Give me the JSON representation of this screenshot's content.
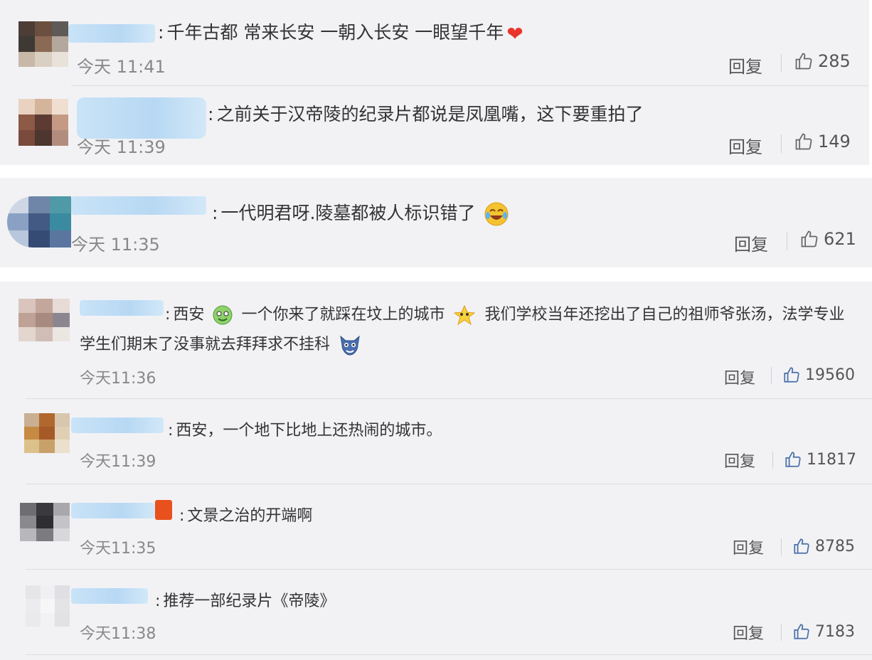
{
  "actions": {
    "reply_label": "回复"
  },
  "comments": [
    {
      "separator": ":",
      "text": "千年古都 常来长安 一朝入长安 一眼望千年",
      "emoji": "heart",
      "time": "今天 11:41",
      "likes": "285"
    },
    {
      "separator": ":",
      "text": "之前关于汉帝陵的纪录片都说是凤凰嘴，这下要重拍了",
      "time": "今天 11:39",
      "likes": "149"
    },
    {
      "separator": ":",
      "text": "一代明君呀.陵墓都被人标识错了",
      "emoji": "crying-laughing-face",
      "time": "今天 11:35",
      "likes": "621"
    },
    {
      "separator": ":",
      "text_a": "西安",
      "text_b": "一个你来了就踩在坟上的城市",
      "text_c": "我们学校当年还挖出了自己的祖师爷张汤，法学专业",
      "text_d": "学生们期末了没事就去拜拜求不挂科",
      "emojis": [
        "green-face",
        "sparkle-star",
        "cat-face"
      ],
      "time": "今天11:36",
      "likes": "19560"
    },
    {
      "separator": ":",
      "text": "西安，一个地下比地上还热闹的城市。",
      "time": "今天11:39",
      "likes": "11817"
    },
    {
      "separator": ":",
      "text": "文景之治的开端啊",
      "time": "今天11:35",
      "likes": "8785"
    },
    {
      "separator": ":",
      "text": "推荐一部纪录片《帝陵》",
      "time": "今天11:38",
      "likes": "7183"
    }
  ],
  "colors": {
    "panel_bg": "#f2f2f5",
    "link": "#555555",
    "time": "#888888",
    "heart": "#e8372a"
  }
}
